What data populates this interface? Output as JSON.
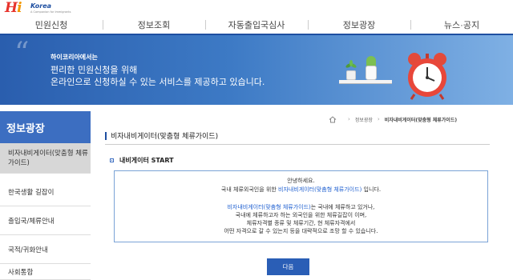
{
  "logo": {
    "brand": "Korea",
    "tagline": "A Companion for Immigrants"
  },
  "gnb": [
    {
      "label": "민원신청"
    },
    {
      "label": "정보조회"
    },
    {
      "label": "자동출입국심사"
    },
    {
      "label": "정보광장"
    },
    {
      "label": "뉴스·공지"
    }
  ],
  "banner": {
    "brand": "하이코리아에서는",
    "line1": "편리한 민원신청을 위해",
    "line2": "온라인으로 신청하실 수 있는 서비스를 제공하고 있습니다."
  },
  "sidebar": {
    "title": "정보광장",
    "items": [
      {
        "label": "비자내비게이터(맞춤형 체류가이드)"
      },
      {
        "label": "한국생활 길잡이"
      },
      {
        "label": "출입국/체류안내"
      },
      {
        "label": "국적/귀화안내"
      },
      {
        "label": "사회통합"
      }
    ]
  },
  "breadcrumb": {
    "parent": "정보광장",
    "current": "비자내비게이터(맞춤형 체류가이드)"
  },
  "page_title": "비자내비게이터(맞춤형 체류가이드)",
  "section_title": "내비게이터 START",
  "info": {
    "greeting": "안녕하세요.",
    "intro_pre": "국내 체류외국인을 위한 ",
    "intro_hl": "비자내비게이터(맞춤형 체류가이드)",
    "intro_post": " 입니다.",
    "desc1_hl": "비자내비게이터(맞춤형 체류가이드)",
    "desc1_post": "는 국내에 체류하고 있거나,",
    "desc2": "국내에 체류하고자 하는 외국인을 위한 체류길잡이 이며,",
    "desc3": "체류자격별 종류 및 체류기간, 현 체류자격에서",
    "desc4": "어떤 자격으로 갈 수 있는지 등을 대략적으로 조망 할 수 있습니다."
  },
  "next_button": "다음"
}
